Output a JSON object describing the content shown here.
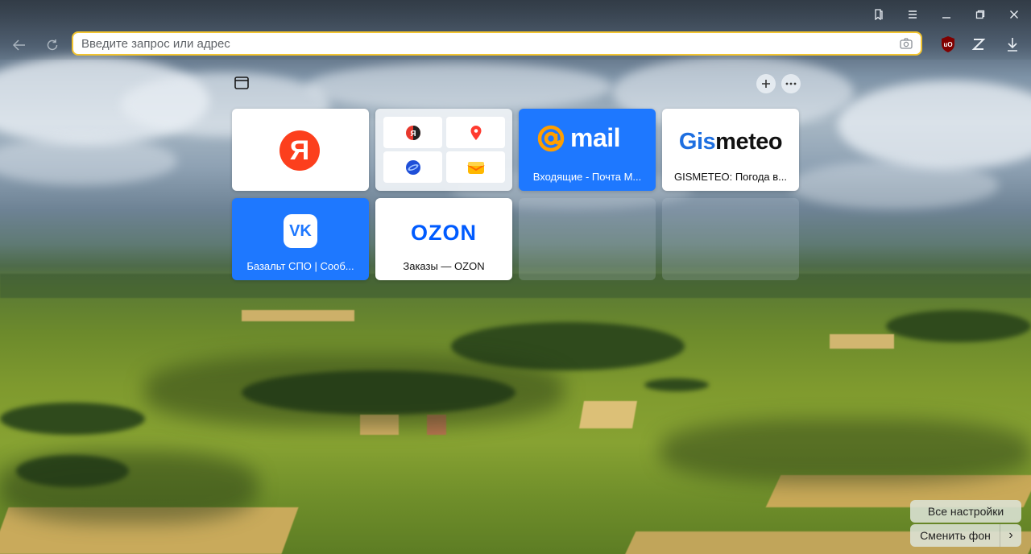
{
  "address_bar": {
    "placeholder": "Введите запрос или адрес"
  },
  "window_controls": {
    "bookmarks_icon": "bookmarks-icon",
    "menu_icon": "hamburger-icon",
    "minimize_icon": "minimize-icon",
    "restore_icon": "restore-icon",
    "close_icon": "close-icon"
  },
  "extensions": [
    {
      "name": "ublock-origin",
      "label": "uO"
    },
    {
      "name": "zen",
      "label": "Z"
    }
  ],
  "tiles": [
    {
      "id": "yandex",
      "logo_text": "Я",
      "caption": ""
    },
    {
      "id": "group",
      "caption": ""
    },
    {
      "id": "mail",
      "logo_text": "mail",
      "caption": "Входящие - Почта М..."
    },
    {
      "id": "gismeteo",
      "logo_text": "Gismeteo",
      "caption": "GISMETEO: Погода в..."
    },
    {
      "id": "vk",
      "logo_text": "VK",
      "caption": "Базальт СПО | Сооб..."
    },
    {
      "id": "ozon",
      "logo_text": "OZON",
      "caption": "Заказы — OZON"
    }
  ],
  "bottom_buttons": {
    "all_settings": "Все настройки",
    "change_background": "Сменить фон",
    "next_arrow": "›"
  },
  "colors": {
    "address_border": "#f2c430",
    "tile_blue": "#1e78ff",
    "yandex_red": "#fc3f1d",
    "ozon_blue": "#005bff",
    "gismeteo_blue": "#1e6fe0"
  }
}
